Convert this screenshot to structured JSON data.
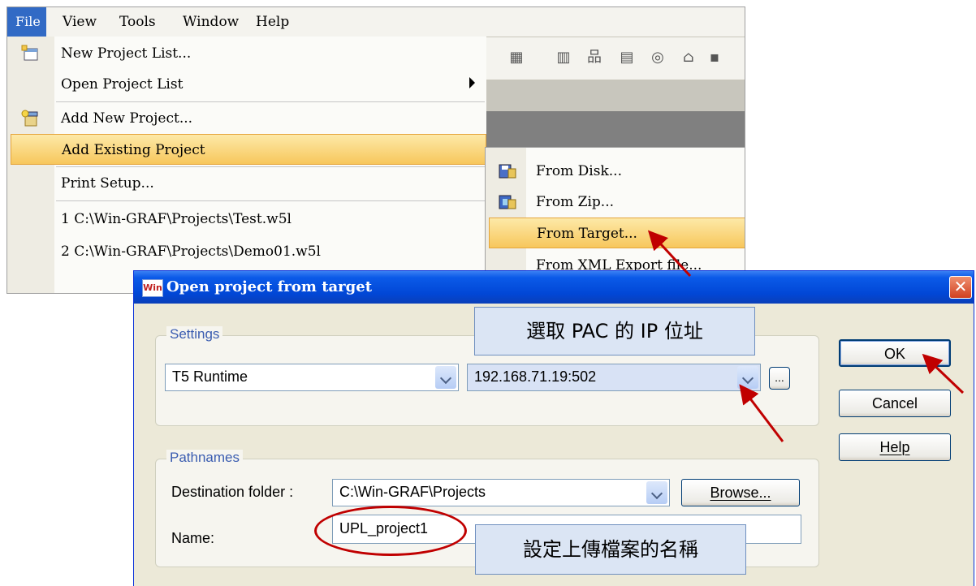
{
  "menubar": {
    "items": [
      "File",
      "View",
      "Tools",
      "Window",
      "Help"
    ]
  },
  "file_menu": {
    "new_project_list": "New Project List...",
    "open_project_list": "Open Project List",
    "add_new_project": "Add New Project...",
    "add_existing_project": "Add Existing Project",
    "print_setup": "Print Setup...",
    "recent_1": "1 C:\\Win-GRAF\\Projects\\Test.w5l",
    "recent_2": "2 C:\\Win-GRAF\\Projects\\Demo01.w5l"
  },
  "submenu": {
    "from_disk": "From Disk...",
    "from_zip": "From Zip...",
    "from_target": "From Target...",
    "from_xml": "From XML Export file..."
  },
  "dialog": {
    "app_icon_text": "Win",
    "title": "Open project from target",
    "settings_label": "Settings",
    "runtime_value": "T5 Runtime",
    "address_value": "192.168.71.19:502",
    "ellipsis_label": "...",
    "pathnames_label": "Pathnames",
    "destination_label": "Destination folder :",
    "destination_value": "C:\\Win-GRAF\\Projects",
    "browse_label": "Browse...",
    "name_label": "Name:",
    "name_value": "UPL_project1",
    "ok_label": "OK",
    "cancel_label": "Cancel",
    "help_label": "Help",
    "close_glyph": "✕"
  },
  "annotations": {
    "callout_ip": "選取 PAC 的 IP 位址",
    "callout_name": "設定上傳檔案的名稱"
  },
  "colors": {
    "arrow": "#c00000",
    "menu_highlight": "#f7c75c",
    "title_bar": "#0147d6"
  }
}
